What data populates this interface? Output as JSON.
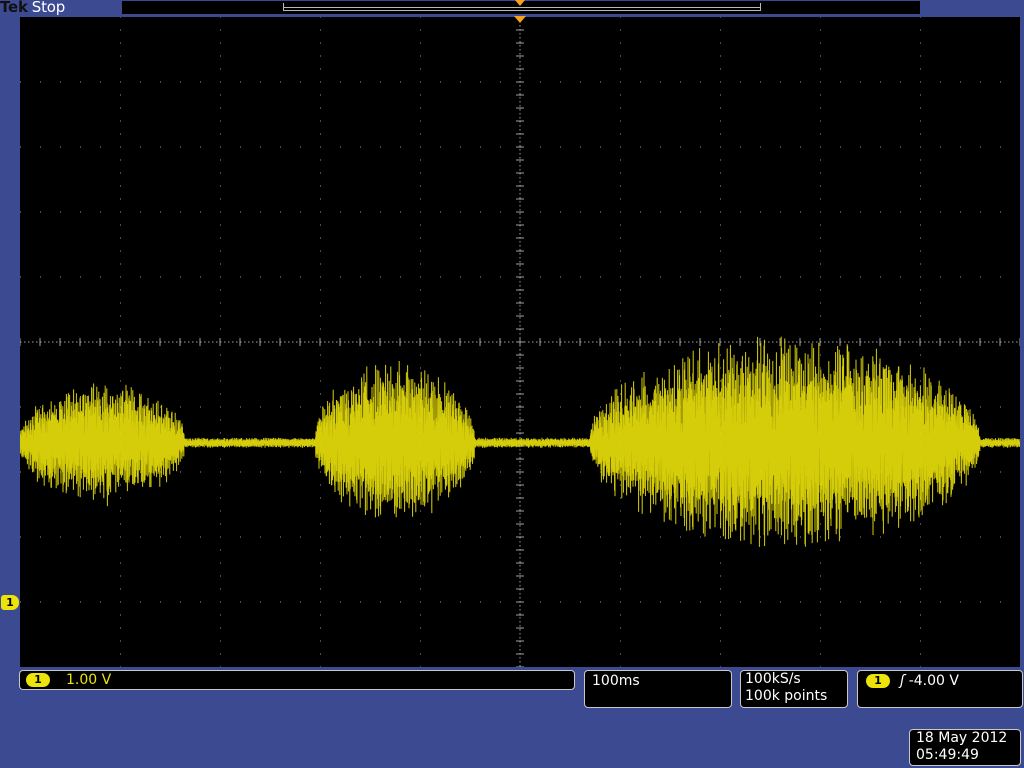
{
  "header": {
    "brand": "Tek",
    "acq_state": "Stop"
  },
  "colors": {
    "trace": "#ece30a",
    "trigger": "#f7a21c",
    "frame": "#3c4a92",
    "screen": "#000000"
  },
  "channel": {
    "id": "1",
    "scale": "1.00 V"
  },
  "horizontal": {
    "timebase": "100ms"
  },
  "acquisition": {
    "sample_rate": "100kS/s",
    "record_length": "100k points"
  },
  "trigger": {
    "source": "1",
    "slope_icon": "rising-edge-icon",
    "slope_glyph": "ʃ",
    "level": "-4.00 V"
  },
  "timestamp": {
    "date": "18 May 2012",
    "time": "05:49:49"
  },
  "waveform": {
    "baseline_div": -1.55,
    "noise_div": 0.08,
    "bursts": [
      {
        "start_div": 0.0,
        "end_div": 1.65,
        "peak_div": 0.9
      },
      {
        "start_div": 2.95,
        "end_div": 4.55,
        "peak_div": 1.2
      },
      {
        "start_div": 5.7,
        "end_div": 9.6,
        "peak_div": 1.6
      }
    ]
  }
}
